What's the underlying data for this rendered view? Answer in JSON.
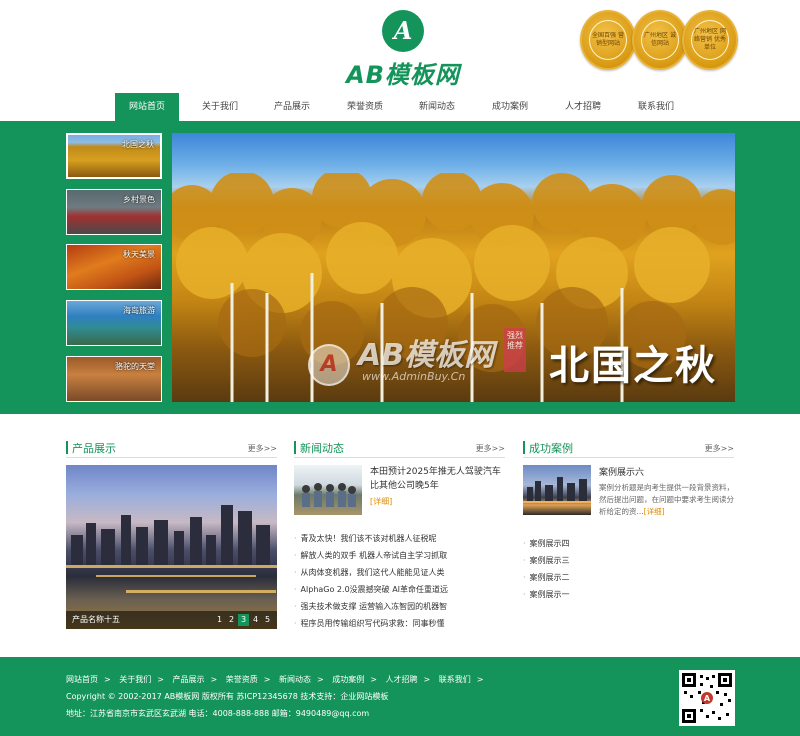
{
  "header": {
    "logo_text": "AB模板网",
    "logo_mark": "A",
    "badges": [
      {
        "text": "全国百强 营销型网站"
      },
      {
        "text": "广州地区 诚信网站"
      },
      {
        "text": "广州地区 网络营销 优秀单位"
      }
    ]
  },
  "nav": {
    "items": [
      "网站首页",
      "关于我们",
      "产品展示",
      "荣誉资质",
      "新闻动态",
      "成功案例",
      "人才招聘",
      "联系我们"
    ],
    "active_index": 0
  },
  "slider": {
    "thumbs": [
      {
        "label": "北国之秋"
      },
      {
        "label": "乡村景色"
      },
      {
        "label": "秋天美景"
      },
      {
        "label": "海岛旅游"
      },
      {
        "label": "骆驼的天堂"
      }
    ],
    "active_index": 0,
    "banner_title": "北国之秋",
    "watermark": {
      "logo": "A",
      "title": "AB模板网",
      "url": "www.AdminBuy.Cn",
      "stamp": "强烈推荐"
    }
  },
  "products": {
    "title": "产品展示",
    "more": "更多>>",
    "current_name": "产品名称十五",
    "pages": [
      "1",
      "2",
      "3",
      "4",
      "5"
    ],
    "current_page": 2
  },
  "news": {
    "title": "新闻动态",
    "more": "更多>>",
    "top": {
      "title": "本田预计2025年推无人驾驶汽车 比其他公司晚5年",
      "more": "[详细]"
    },
    "items": [
      "青及太快！我们该不该对机器人征税呢",
      "解放人类的双手 机器人帝试自主学习抓取",
      "从肉体变机器，我们这代人能能见证人类",
      "AlphaGo 2.0没震撼突破 AI革命任重道远",
      "强夫技术做支撑 运营输入冻智园的机器智",
      "程序员用传输组织写代码求救：同事秒懂"
    ]
  },
  "cases": {
    "title": "成功案例",
    "more": "更多>>",
    "top": {
      "title": "案例展示六",
      "desc": "案例分析题是向考生提供一段背景资料，然后提出问题，在问题中要求考生阅读分析给定的资...",
      "more": "[详细]"
    },
    "items": [
      "案例展示四",
      "案例展示三",
      "案例展示二",
      "案例展示一"
    ]
  },
  "footer": {
    "nav": [
      "网站首页",
      "关于我们",
      "产品展示",
      "荣誉资质",
      "新闻动态",
      "成功案例",
      "人才招聘",
      "联系我们"
    ],
    "separator": ">",
    "copyright": "Copyright © 2002-2017 AB模板网 版权所有 苏ICP12345678 技术支持：企业网站模板",
    "address": "地址：江苏省南京市玄武区玄武湖   电话：4008-888-888   邮箱：9490489@qq.com"
  },
  "colors": {
    "brand_green": "#14945a",
    "accent_orange": "#e08a00",
    "badge_gold": "#d99a12"
  }
}
